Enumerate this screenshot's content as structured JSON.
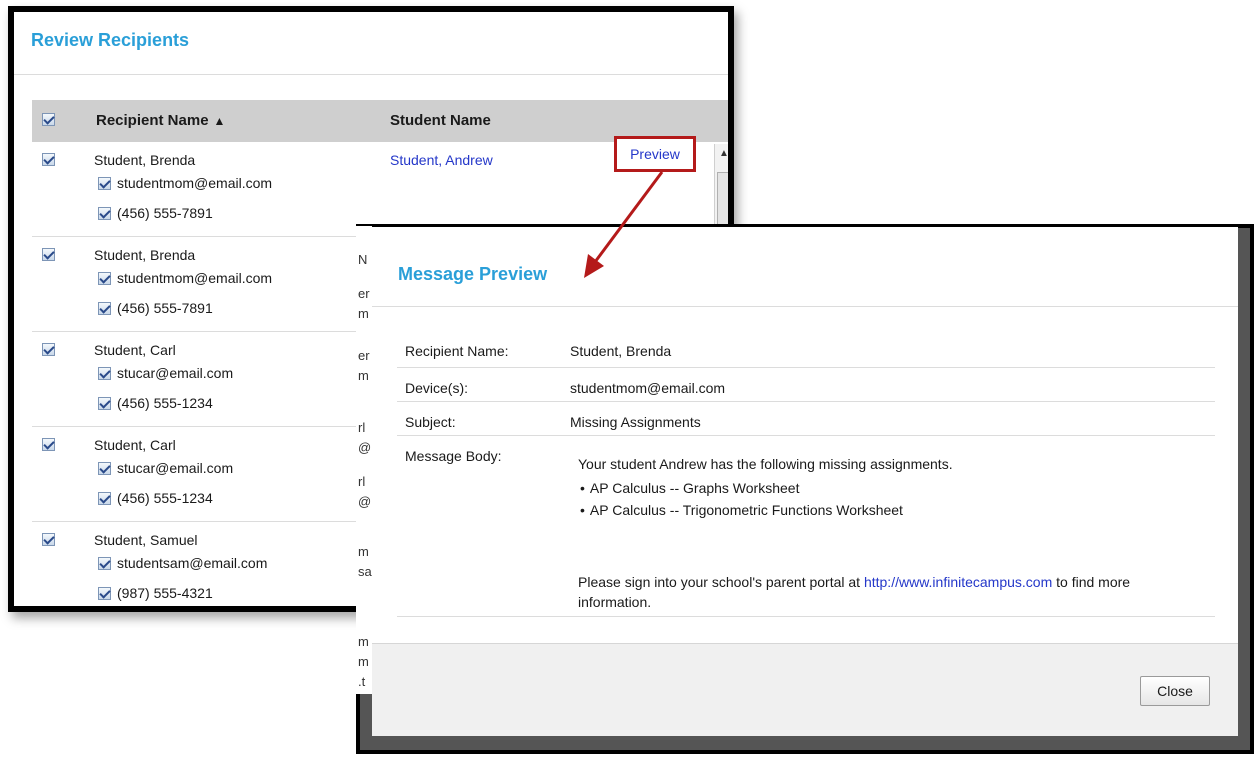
{
  "review": {
    "title": "Review Recipients",
    "columns": {
      "recipient": "Recipient Name",
      "student": "Student Name"
    },
    "sort_icon": "triangle-up-icon",
    "preview_label": "Preview",
    "rows": [
      {
        "name": "Student, Brenda",
        "student": "Student, Andrew",
        "email": "studentmom@email.com",
        "phone": "(456) 555-7891"
      },
      {
        "name": "Student, Brenda",
        "student": "",
        "email": "studentmom@email.com",
        "phone": "(456) 555-7891"
      },
      {
        "name": "Student, Carl",
        "student": "",
        "email": "stucar@email.com",
        "phone": "(456) 555-1234"
      },
      {
        "name": "Student, Carl",
        "student": "",
        "email": "stucar@email.com",
        "phone": "(456) 555-1234"
      },
      {
        "name": "Student, Samuel",
        "student": "",
        "email": "studentsam@email.com",
        "phone": "(987) 555-4321"
      }
    ]
  },
  "peek_chars": [
    "N",
    "er",
    "m",
    "er",
    "m",
    "rl",
    "@",
    "rl",
    "@",
    "m",
    "sa",
    "m",
    "m",
    ".t"
  ],
  "preview": {
    "title": "Message Preview",
    "fields": {
      "recipient_label": "Recipient Name:",
      "recipient_value": "Student, Brenda",
      "devices_label": "Device(s):",
      "devices_value": "studentmom@email.com",
      "subject_label": "Subject:",
      "subject_value": "Missing Assignments",
      "body_label": "Message Body:"
    },
    "body": {
      "intro": "Your student Andrew has the following missing assignments.",
      "bullets": [
        "AP Calculus -- Graphs Worksheet",
        "AP Calculus -- Trigonometric Functions Worksheet"
      ],
      "footer_before": "Please sign into your school's parent portal at ",
      "link": "http://www.infinitecampus.com",
      "footer_after": " to find more information."
    },
    "close_label": "Close"
  },
  "colors": {
    "accent": "#2a9fd8",
    "link": "#2437c9",
    "callout": "#b41a1a"
  }
}
